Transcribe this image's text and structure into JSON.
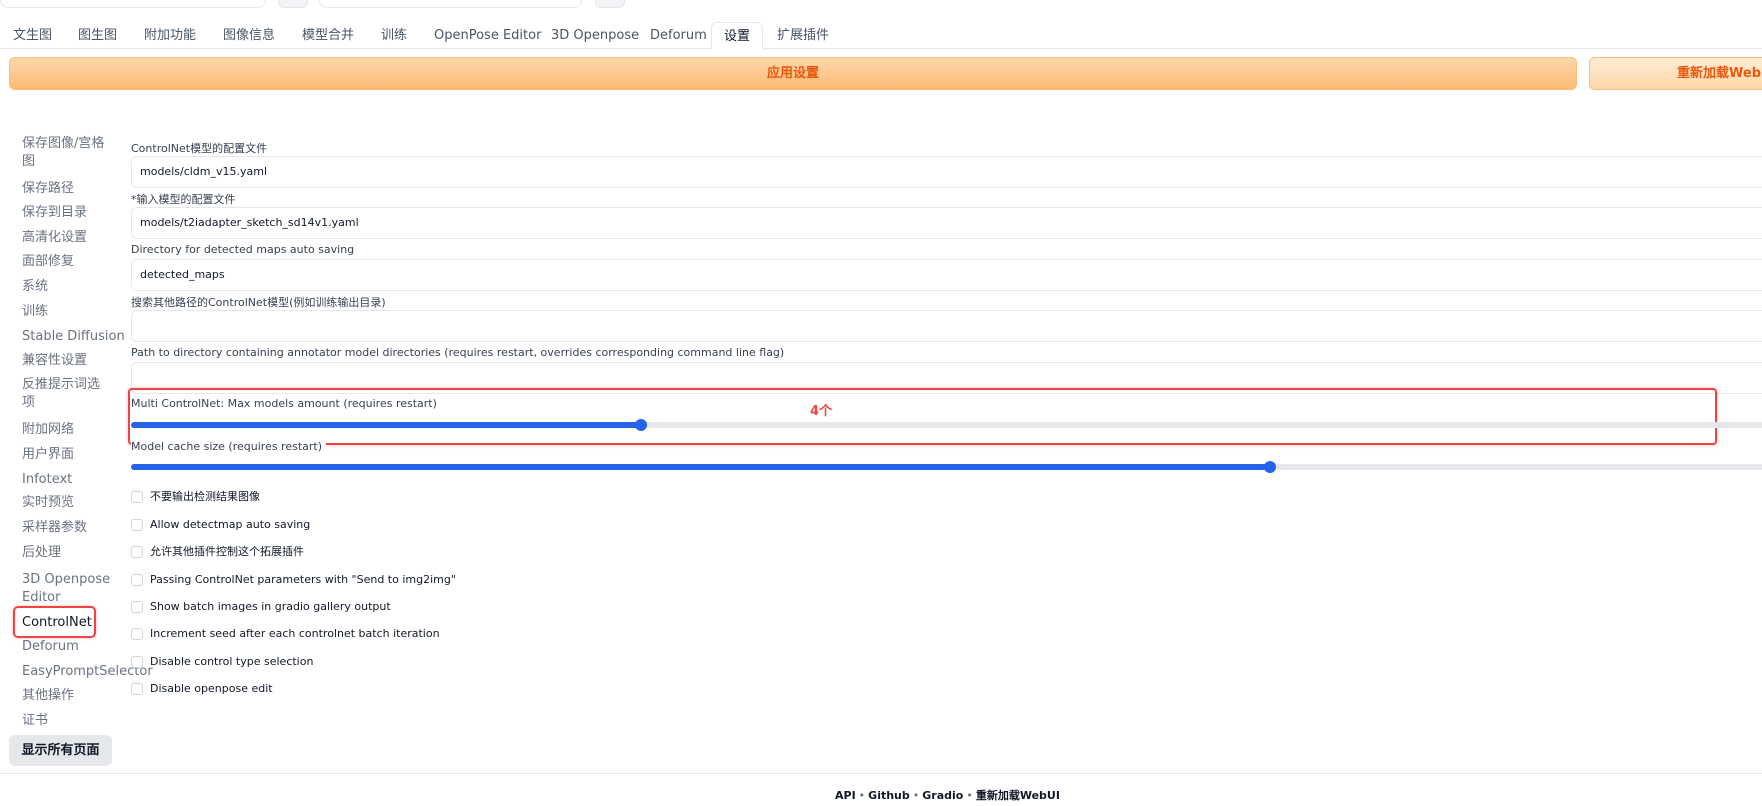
{
  "tabs": [
    {
      "label": "文生图"
    },
    {
      "label": "图生图"
    },
    {
      "label": "附加功能"
    },
    {
      "label": "图像信息"
    },
    {
      "label": "模型合并"
    },
    {
      "label": "训练"
    },
    {
      "label": "OpenPose Editor"
    },
    {
      "label": "3D Openpose"
    },
    {
      "label": "Deforum"
    },
    {
      "label": "设置"
    },
    {
      "label": "扩展插件"
    }
  ],
  "active_tab": "设置",
  "toolbar": {
    "apply_label": "应用设置",
    "reload_label": "重新加载WebUI"
  },
  "sidebar": {
    "items": [
      {
        "label": "保存图像/宫格图"
      },
      {
        "label": "保存路径"
      },
      {
        "label": "保存到目录"
      },
      {
        "label": "高清化设置"
      },
      {
        "label": "面部修复"
      },
      {
        "label": "系统"
      },
      {
        "label": "训练"
      },
      {
        "label": "Stable Diffusion"
      },
      {
        "label": "兼容性设置"
      },
      {
        "label": "反推提示词选项"
      },
      {
        "label": "附加网络"
      },
      {
        "label": "用户界面"
      },
      {
        "label": "Infotext"
      },
      {
        "label": "实时预览"
      },
      {
        "label": "采样器参数"
      },
      {
        "label": "后处理"
      },
      {
        "label": "3D Openpose Editor"
      },
      {
        "label": "ControlNet"
      },
      {
        "label": "Deforum"
      },
      {
        "label": "EasyPromptSelector"
      },
      {
        "label": "其他操作"
      },
      {
        "label": "证书"
      }
    ],
    "selected": "ControlNet",
    "show_all_label": "显示所有页面"
  },
  "settings": {
    "controlnet_config": {
      "label": "ControlNet模型的配置文件",
      "value": "models/cldm_v15.yaml"
    },
    "adapter_config": {
      "label": "*输入模型的配置文件",
      "value": "models/t2iadapter_sketch_sd14v1.yaml"
    },
    "detected_maps_dir": {
      "label": "Directory for detected maps auto saving",
      "value": "detected_maps"
    },
    "extra_models_path": {
      "label": "搜索其他路径的ControlNet模型(例如训练输出目录)",
      "value": ""
    },
    "annotator_path": {
      "label": "Path to directory containing annotator model directories (requires restart, overrides corresponding command line flag)",
      "value": ""
    },
    "multi_controlnet": {
      "label": "Multi ControlNet: Max models amount (requires restart)",
      "fraction": 0.309
    },
    "model_cache": {
      "label": "Model cache size (requires restart)",
      "fraction": 0.69
    }
  },
  "annotation_text": "4个",
  "checkboxes": [
    {
      "label": "不要输出检测结果图像",
      "checked": false
    },
    {
      "label": "Allow detectmap auto saving",
      "checked": false
    },
    {
      "label": "允许其他插件控制这个拓展插件",
      "checked": false
    },
    {
      "label": "Passing ControlNet parameters with \"Send to img2img\"",
      "checked": false
    },
    {
      "label": "Show batch images in gradio gallery output",
      "checked": false
    },
    {
      "label": "Increment seed after each controlnet batch iteration",
      "checked": false
    },
    {
      "label": "Disable control type selection",
      "checked": false
    },
    {
      "label": "Disable openpose edit",
      "checked": false
    }
  ],
  "footer": {
    "api": "API",
    "github": "Github",
    "gradio": "Gradio",
    "reload": "重新加载WebUI",
    "sep": "•"
  },
  "colors": {
    "accent": "#2563eb",
    "apply_text": "#ea580c",
    "annotation": "#ef4444"
  }
}
